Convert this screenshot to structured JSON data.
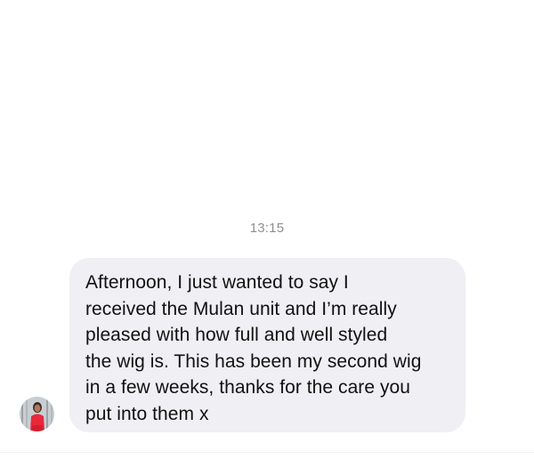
{
  "conversation": {
    "timestamp": "13:15",
    "messages": [
      {
        "text": "Afternoon, I just wanted to say I\nreceived the Mulan unit and I’m really\npleased with how full and well styled\nthe wig is. This has been my second wig\nin a few weeks, thanks for the care you\nput into them x",
        "avatar_icon": "sender-avatar"
      }
    ]
  },
  "colors": {
    "background": "#ffffff",
    "bubble": "#efeff4",
    "timestamp": "#8e8e93",
    "text": "#111111"
  }
}
